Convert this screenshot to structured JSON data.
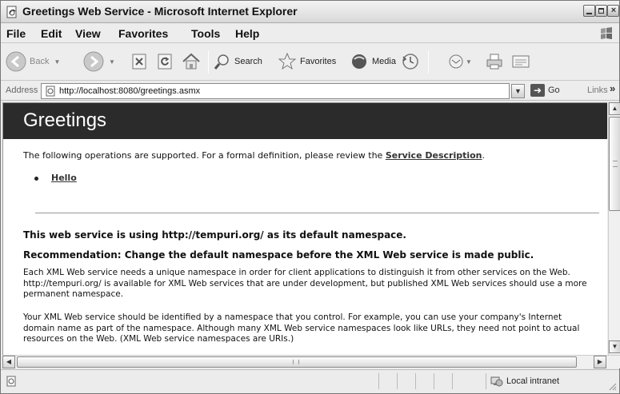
{
  "window": {
    "title": "Greetings Web Service - Microsoft Internet Explorer"
  },
  "menu": [
    "File",
    "Edit",
    "View",
    "Favorites",
    "Tools",
    "Help"
  ],
  "toolbar": {
    "back_label": "Back",
    "search_label": "Search",
    "favorites_label": "Favorites",
    "media_label": "Media"
  },
  "address": {
    "label": "Address",
    "url": "http://localhost:8080/greetings.asmx",
    "go_label": "Go",
    "links_label": "Links",
    "links_chevron": "»"
  },
  "page": {
    "title": "Greetings",
    "intro": "The following operations are supported. For a formal definition, please review the ",
    "service_description_link": "Service Description",
    "intro_end": ".",
    "operations": [
      "Hello"
    ],
    "namespace_heading": "This web service is using http://tempuri.org/ as its default namespace.",
    "recommendation_heading": "Recommendation: Change the default namespace before the XML Web service is made public.",
    "paragraph_1": "Each XML Web service needs a unique namespace in order for client applications to distinguish it from other services on the Web. http://tempuri.org/ is available for XML Web services that are under development, but published XML Web services should use a more permanent namespace.",
    "paragraph_2": "Your XML Web service should be identified by a namespace that you control. For example, you can use your company's Internet domain name as part of the namespace. Although many XML Web service namespaces look like URLs, they need not point to actual resources on the Web. (XML Web service namespaces are URIs.)"
  },
  "status": {
    "zone": "Local intranet"
  },
  "icons": {
    "title": "ie-page-icon",
    "back": "back-arrow-icon",
    "forward": "forward-arrow-icon",
    "stop": "stop-icon",
    "refresh": "refresh-icon",
    "home": "home-icon",
    "search": "search-icon",
    "favorites": "favorites-star-icon",
    "media": "media-icon",
    "history": "history-icon",
    "mail": "mail-icon",
    "print": "print-icon",
    "edit": "edit-icon"
  }
}
